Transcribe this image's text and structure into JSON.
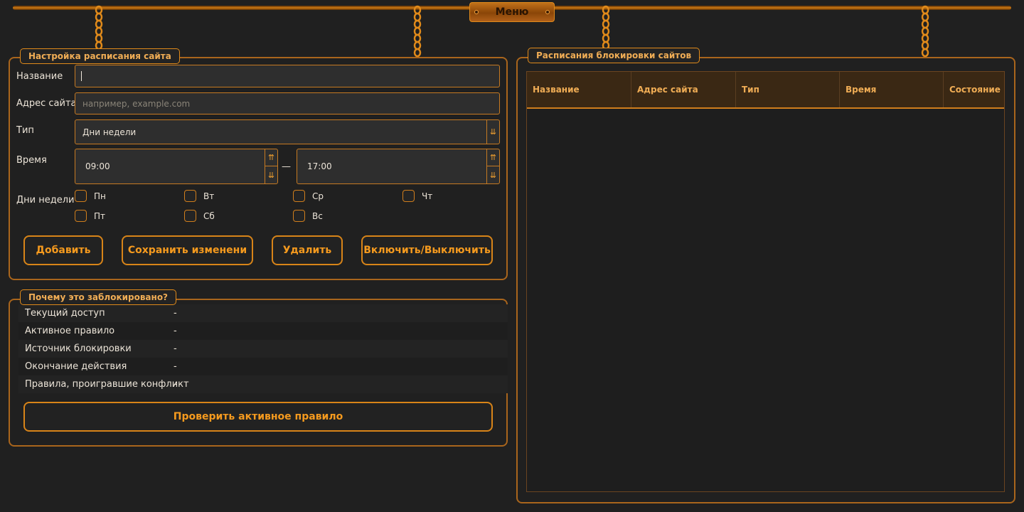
{
  "top": {
    "menu_label": "Меню"
  },
  "schedule_form": {
    "title": "Настройка расписания сайта",
    "name_label": "Название",
    "name_value": "",
    "site_label": "Адрес сайта",
    "site_placeholder": "например, example.com",
    "type_label": "Тип",
    "type_value": "Дни недели",
    "time_label": "Время",
    "time_from": "09:00",
    "time_sep": "—",
    "time_to": "17:00",
    "days_label": "Дни недели",
    "days": [
      "Пн",
      "Вт",
      "Ср",
      "Чт",
      "Пт",
      "Сб",
      "Вс"
    ],
    "buttons": {
      "add": "Добавить",
      "save": "Сохранить изменени",
      "delete": "Удалить",
      "toggle": "Включить/Выключить"
    }
  },
  "why_blocked": {
    "title": "Почему это заблокировано?",
    "rows": [
      {
        "key": "Текущий доступ",
        "value": "-"
      },
      {
        "key": "Активное правило",
        "value": "-"
      },
      {
        "key": "Источник блокировки",
        "value": "-"
      },
      {
        "key": "Окончание действия",
        "value": "-"
      },
      {
        "key": "Правила, проигравшие конфликт",
        "value": "-"
      }
    ],
    "check_button": "Проверить активное правило"
  },
  "schedules_table": {
    "title": "Расписания блокировки сайтов",
    "columns": [
      "Название",
      "Адрес сайта",
      "Тип",
      "Время",
      "Состояние"
    ],
    "rows": []
  },
  "colors": {
    "accent": "#f59a1e",
    "border": "#c67a22",
    "background": "#202020"
  },
  "icons": {
    "dropdown": "double-arrow-down-icon",
    "spin_up": "double-arrow-up-icon",
    "spin_down": "double-arrow-down-icon"
  }
}
